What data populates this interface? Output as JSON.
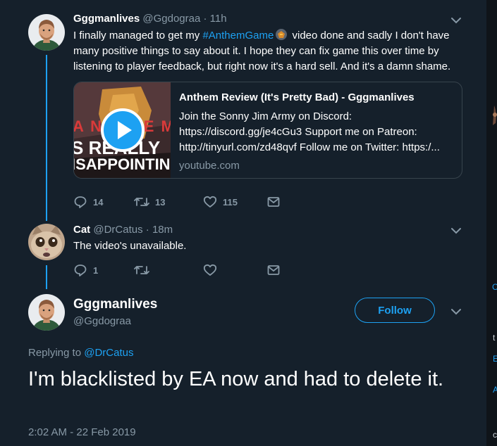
{
  "tweet1": {
    "name": "Gggmanlives",
    "handle": "@Ggdograa",
    "sep": "·",
    "time": "11h",
    "text_before": "I finally managed to get my ",
    "hashtag": "#AnthemGame",
    "text_after": " video done and sadly I don't have many positive things to say about it. I hope they can fix game this over time by listening to player feedback, but right now it's a hard sell. And it's a damn shame.",
    "card": {
      "title": "Anthem Review (It's Pretty Bad) - Gggmanlives",
      "description": "Join the Sonny Jim Army on Discord: https://discord.gg/je4cGu3 Support me on Patreon: http://tinyurl.com/zd48qvf Follow me on Twitter: https:/...",
      "domain": "youtube.com",
      "thumb_line1": "A N T H E M",
      "thumb_line2": "S REALLY",
      "thumb_line3": "ISAPPOINTIN"
    },
    "replies": "14",
    "retweets": "13",
    "likes": "115"
  },
  "tweet2": {
    "name": "Cat",
    "handle": "@DrCatus",
    "sep": "·",
    "time": "18m",
    "text": "The video's unavailable.",
    "replies": "1"
  },
  "focus": {
    "name": "Gggmanlives",
    "handle": "@Ggdograa",
    "follow_label": "Follow",
    "replying_prefix": "Replying to ",
    "replying_to": "@DrCatus",
    "text": "I'm blacklisted by EA now and had to delete it.",
    "timestamp": "2:02 AM - 22 Feb 2019"
  },
  "colors": {
    "background": "#15202b",
    "accent": "#1da1f2",
    "secondary_text": "#8899a6",
    "border": "#38444d"
  },
  "icons": [
    "reply-icon",
    "retweet-icon",
    "like-icon",
    "message-icon",
    "chevron-down-icon",
    "play-icon"
  ]
}
